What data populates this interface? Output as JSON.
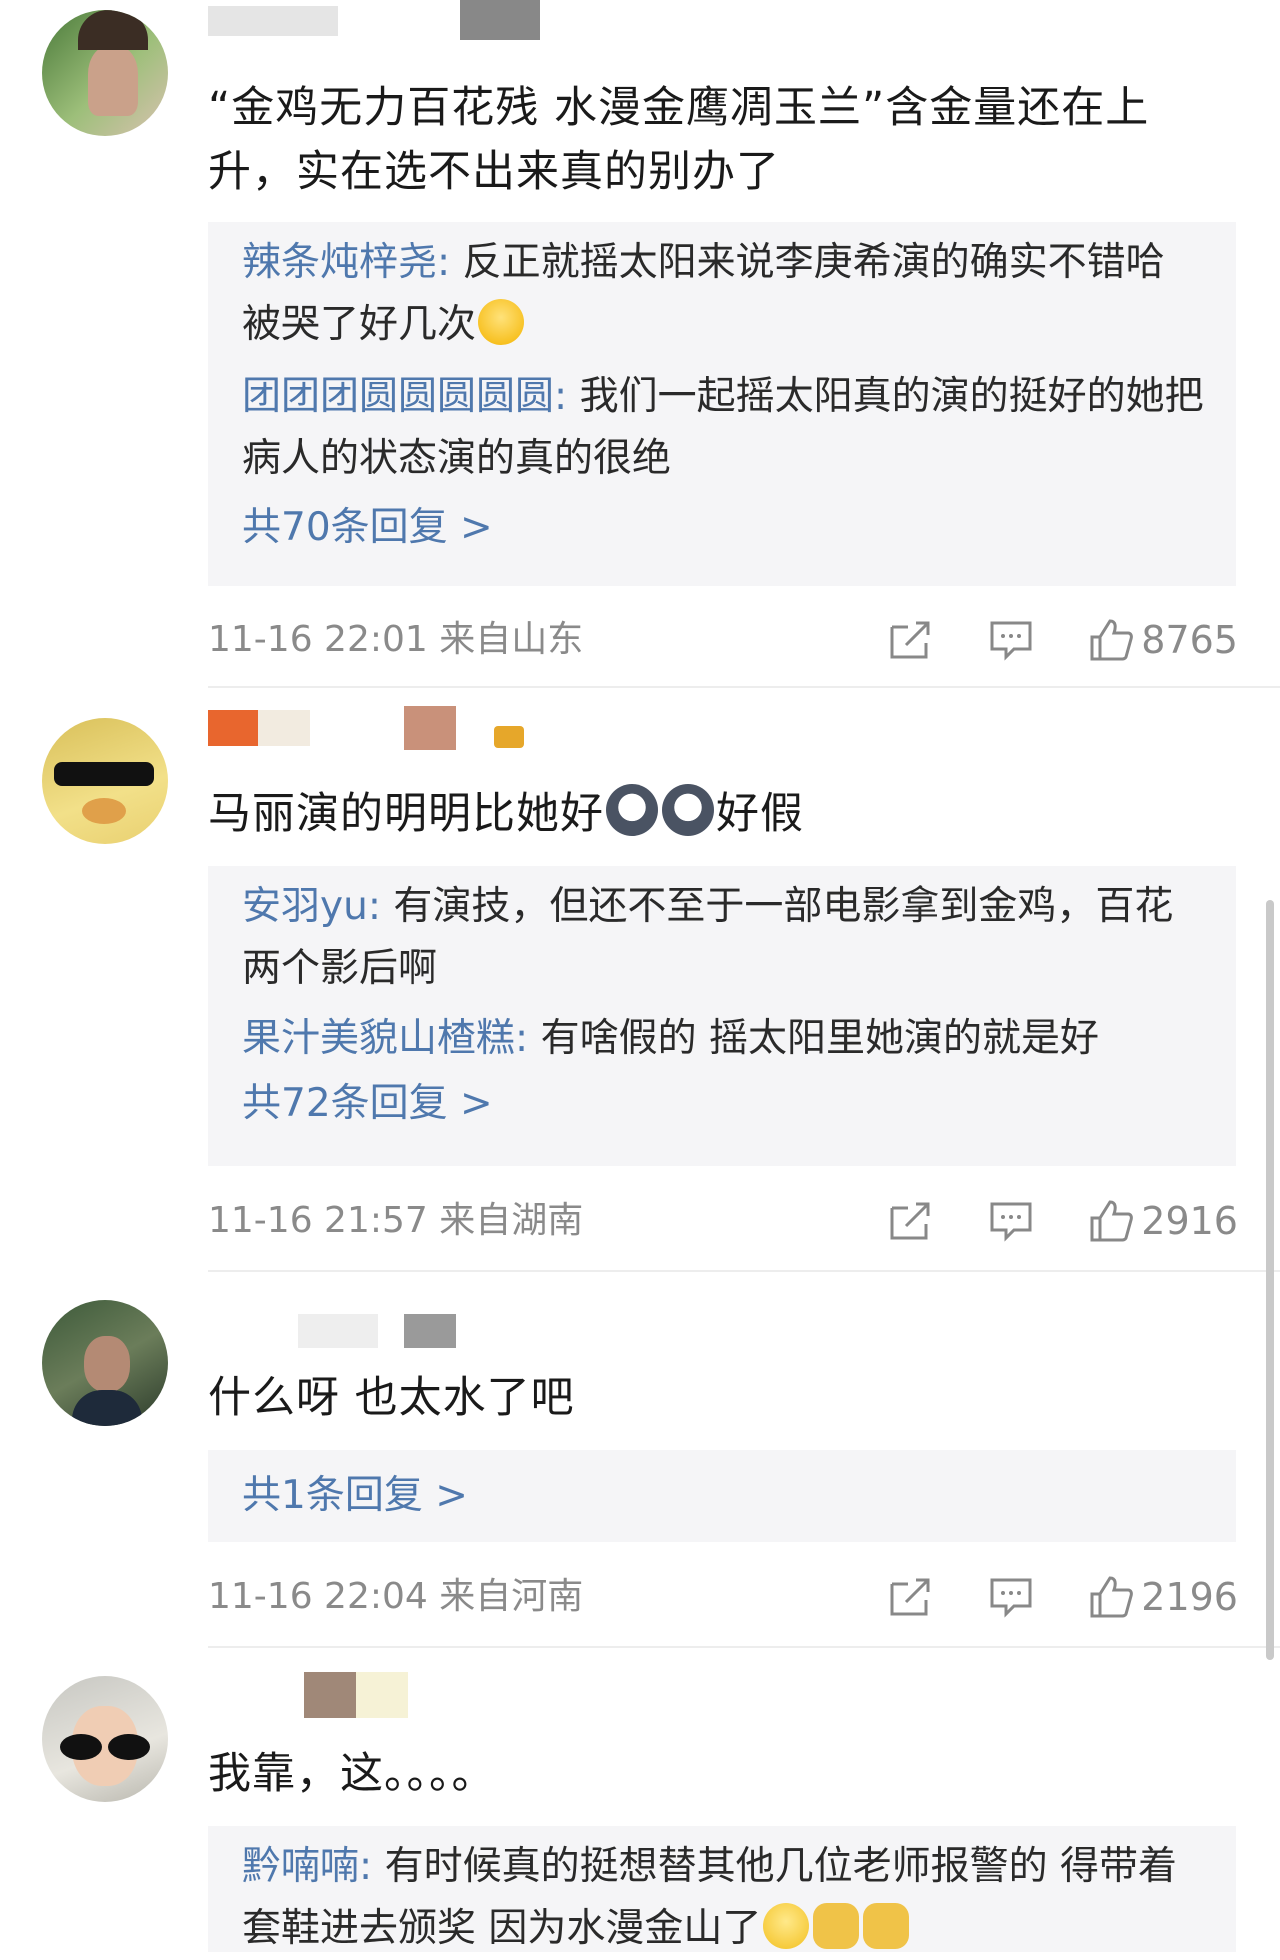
{
  "comments": [
    {
      "body": "“金鸡无力百花残 水漫金鹰凋玉兰”含金量还在上升，实在选不出来真的别办了",
      "replies": [
        {
          "name": "辣条炖梓尧",
          "text": "反正就摇太阳来说李庚希演的确实不错哈 被哭了好几次"
        },
        {
          "name": "团团团圆圆圆圆圆",
          "text": "我们一起摇太阳真的演的挺好的她把病人的状态演的真的很绝"
        }
      ],
      "more": "共70条回复 >",
      "time": "11-16 22:01",
      "location": "来自山东",
      "likes": "8765"
    },
    {
      "body": "马丽演的明明比她好",
      "body_suffix": "好假",
      "replies": [
        {
          "name": "安羽yu",
          "text": "有演技，但还不至于一部电影拿到金鸡，百花两个影后啊"
        },
        {
          "name": "果汁美貌山楂糕",
          "text": "有啥假的 摇太阳里她演的就是好"
        }
      ],
      "more": "共72条回复 >",
      "time": "11-16 21:57",
      "location": "来自湖南",
      "likes": "2916"
    },
    {
      "body": "什么呀 也太水了吧",
      "replies": [],
      "more": "共1条回复 >",
      "time": "11-16 22:04",
      "location": "来自河南",
      "likes": "2196"
    },
    {
      "body": "我靠，这。。。。",
      "replies": [
        {
          "name": "黔喃喃",
          "text": "有时候真的挺想替其他几位老师报警的 得带着套鞋进去颁奖 因为水漫金山了"
        }
      ]
    }
  ],
  "icons": {
    "share": "share-icon",
    "comment": "comment-icon",
    "like": "thumbs-up-icon"
  },
  "colors": {
    "link": "#4f78ad",
    "reply_bg": "#f5f5f7",
    "meta": "#8a8a8a"
  }
}
